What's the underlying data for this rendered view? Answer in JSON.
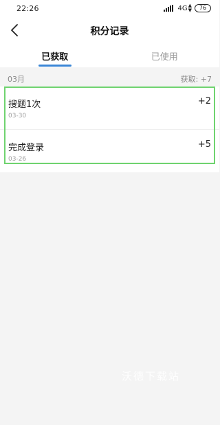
{
  "status_bar": {
    "time": "22:26",
    "network": "4G",
    "battery": "76"
  },
  "header": {
    "title": "积分记录",
    "back_icon": "chevron-left-icon"
  },
  "tabs": [
    {
      "label": "已获取",
      "active": true
    },
    {
      "label": "已使用",
      "active": false
    }
  ],
  "month_group": {
    "month": "03月",
    "summary": "获取: +7"
  },
  "records": [
    {
      "name": "搜题1次",
      "date": "03-30",
      "points": "+2"
    },
    {
      "name": "完成登录",
      "date": "03-26",
      "points": "+5"
    }
  ],
  "watermark": "沃德下载站",
  "colors": {
    "accent": "#3a86d6",
    "highlight": "#6fd36f",
    "background": "#f4f4f4"
  }
}
